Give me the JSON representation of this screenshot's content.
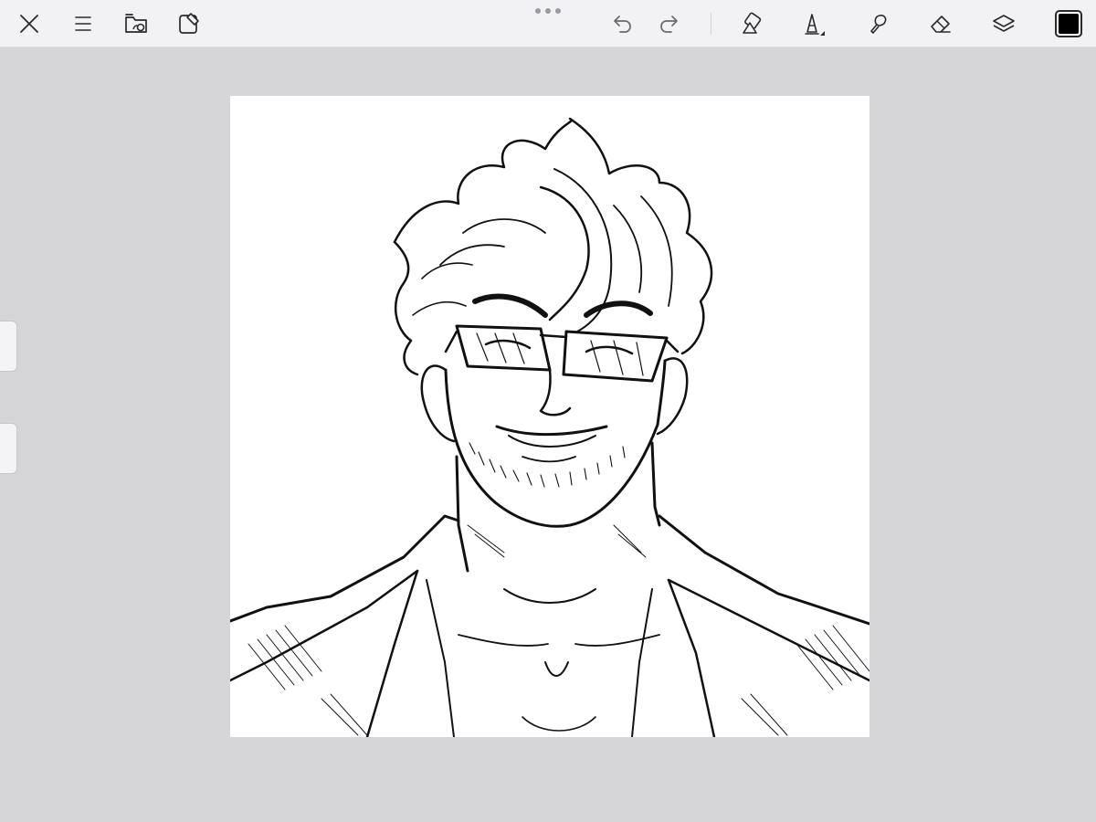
{
  "app": {
    "accent_color": "#000000",
    "background_color": "#d5d5d8",
    "toolbar_color": "#f2f2f4"
  },
  "toolbar": {
    "left_tools": [
      {
        "icon": "close-icon"
      },
      {
        "icon": "menu-icon"
      },
      {
        "icon": "gallery-folder-icon"
      },
      {
        "icon": "actions-icon"
      }
    ],
    "history_tools": [
      {
        "icon": "undo-icon"
      },
      {
        "icon": "redo-icon"
      }
    ],
    "right_tools": [
      {
        "icon": "shapes-icon"
      },
      {
        "icon": "pencil-brush-icon"
      },
      {
        "icon": "smudge-icon"
      },
      {
        "icon": "eraser-icon"
      },
      {
        "icon": "layers-icon"
      }
    ],
    "current_color": "#000000"
  },
  "side_sliders": [
    {
      "icon": "brush-size-slider"
    },
    {
      "icon": "opacity-slider"
    }
  ],
  "canvas": {
    "background": "#ffffff",
    "artwork": "line-art-portrait"
  }
}
